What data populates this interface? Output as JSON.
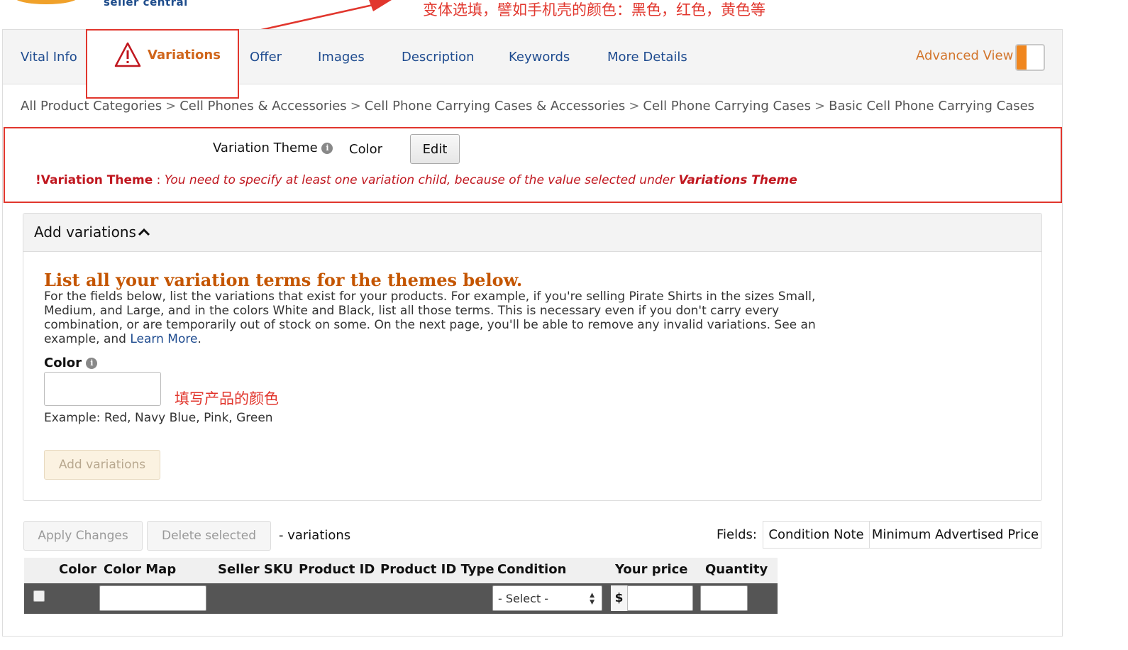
{
  "logo": {
    "text": "seller central"
  },
  "annotations": {
    "top": "变体选填，譬如手机壳的颜色：黑色，红色，黄色等",
    "color_field": "填写产品的颜色"
  },
  "tabs": [
    {
      "label": "Vital Info"
    },
    {
      "label": "Variations",
      "active": true,
      "icon": "warning-icon"
    },
    {
      "label": "Offer"
    },
    {
      "label": "Images"
    },
    {
      "label": "Description"
    },
    {
      "label": "Keywords"
    },
    {
      "label": "More Details"
    }
  ],
  "advanced_view": {
    "label": "Advanced View",
    "enabled": false
  },
  "breadcrumb": [
    "All Product Categories",
    "Cell Phones & Accessories",
    "Cell Phone Carrying Cases & Accessories",
    "Cell Phone Carrying Cases",
    "Basic Cell Phone Carrying Cases"
  ],
  "breadcrumb_separator": ">",
  "variation_theme": {
    "label": "Variation Theme",
    "value": "Color",
    "edit_label": "Edit",
    "error_mark": "!",
    "error_field": "Variation Theme",
    "error_colon": " : ",
    "error_message": "You need to specify at least one variation child, because of the value selected under ",
    "error_emphasis": "Variations Theme"
  },
  "add_variations": {
    "title": "Add variations",
    "heading": "List all your variation terms for the themes below.",
    "description": "For the fields below, list the variations that exist for your products. For example, if you're selling Pirate Shirts in the sizes Small, Medium, and Large, and in the colors White and Black, list all those terms. This is necessary even if you don't carry every combination, or are temporarily out of stock on some. On the next page, you'll be able to remove any invalid variations. See an example, and ",
    "learn_more": "Learn More",
    "learn_more_suffix": ".",
    "color_label": "Color",
    "color_value": "",
    "example": "Example:  Red, Navy Blue, Pink, Green",
    "add_button": "Add variations"
  },
  "toolbar": {
    "apply_changes": "Apply Changes",
    "delete_selected": "Delete selected",
    "variations_count": "- variations",
    "fields_label": "Fields:",
    "field_buttons": [
      "Condition Note",
      "Minimum Advertised Price"
    ]
  },
  "table": {
    "columns": [
      "Color",
      "Color Map",
      "Seller SKU",
      "Product ID",
      "Product ID Type",
      "Condition",
      "Your price",
      "Quantity"
    ],
    "row": {
      "checked": false,
      "color_map": "",
      "condition": "- Select -",
      "currency": "$",
      "price": "",
      "quantity": ""
    }
  },
  "colors": {
    "accent_orange": "#c45500",
    "error_red": "#c0171f",
    "annotation_red": "#e1362d",
    "link_blue": "#1e4b8f"
  }
}
